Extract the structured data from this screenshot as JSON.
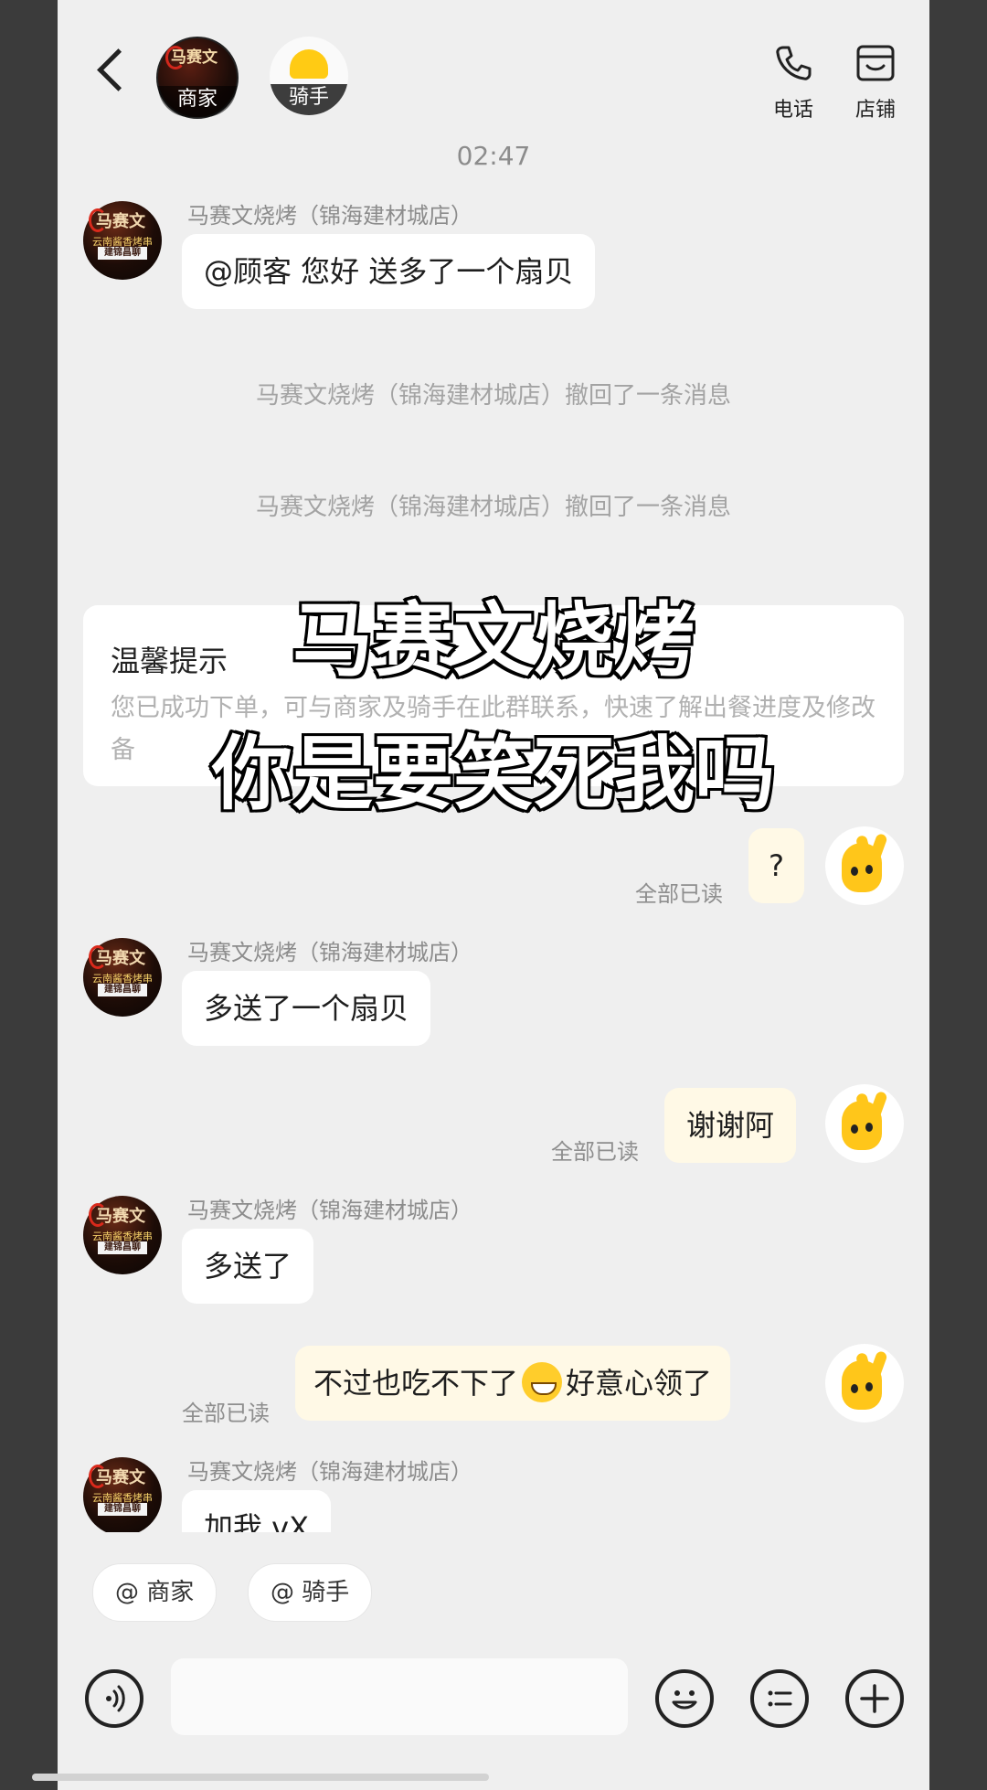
{
  "header": {
    "shop_tag": "商家",
    "shop_mark": "马赛文",
    "rider_tag": "骑手",
    "phone_label": "电话",
    "store_label": "店铺"
  },
  "chat": {
    "timestamp": "02:47",
    "sender_name": "马赛文烧烤（锦海建材城店）",
    "avatar_text_1": "马赛文",
    "avatar_text_2": "云南酱香烤串",
    "avatar_text_3": "建锦昌聊",
    "messages": [
      {
        "from": "shop",
        "text": "@顾客 您好 送多了一个扇贝"
      },
      {
        "from": "system",
        "text": "马赛文烧烤（锦海建材城店）撤回了一条消息"
      },
      {
        "from": "system",
        "text": "马赛文烧烤（锦海建材城店）撤回了一条消息"
      },
      {
        "from": "me",
        "text": "?",
        "status": "全部已读"
      },
      {
        "from": "shop",
        "text": "多送了一个扇贝"
      },
      {
        "from": "me",
        "text": "谢谢阿",
        "status": "全部已读"
      },
      {
        "from": "shop",
        "text": "多送了"
      },
      {
        "from": "me",
        "text_before": "不过也吃不下了",
        "emoji": "grin-emoji",
        "text_after": "好意心领了",
        "status": "全部已读"
      },
      {
        "from": "shop",
        "text": "加我 vX"
      }
    ],
    "tip": {
      "title": "温馨提示",
      "body": "您已成功下单，可与商家及骑手在此群联系，快速了解出餐进度及修改备"
    }
  },
  "overlay": {
    "line1": "马赛文烧烤",
    "line2": "你是要笑死我吗"
  },
  "composer": {
    "chip_shop": "@ 商家",
    "chip_rider": "@ 骑手",
    "input_value": "",
    "input_placeholder": ""
  },
  "colors": {
    "background": "#efefef",
    "bubble_other": "#ffffff",
    "bubble_me": "#fff9e6",
    "muted_text": "#8c8c8c",
    "accent_yellow": "#ffc61a"
  }
}
